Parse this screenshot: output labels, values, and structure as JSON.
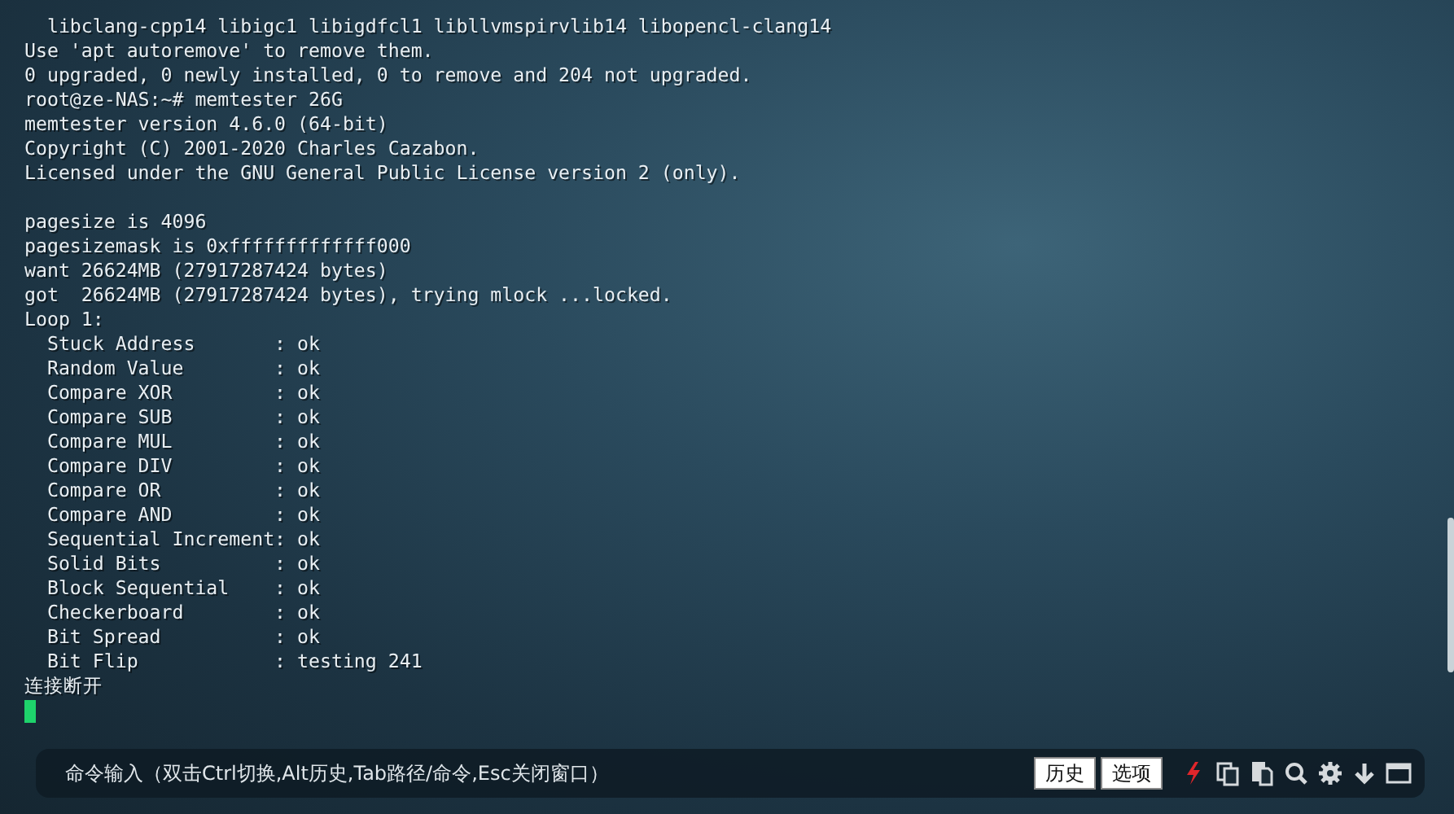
{
  "terminal": {
    "blocks": [
      [
        "  libclang-cpp14 libigc1 libigdfcl1 libllvmspirvlib14 libopencl-clang14",
        "Use 'apt autoremove' to remove them.",
        "0 upgraded, 0 newly installed, 0 to remove and 204 not upgraded.",
        "root@ze-NAS:~# memtester 26G",
        "memtester version 4.6.0 (64-bit)",
        "Copyright (C) 2001-2020 Charles Cazabon.",
        "Licensed under the GNU General Public License version 2 (only)."
      ],
      [
        "pagesize is 4096",
        "pagesizemask is 0xfffffffffffff000",
        "want 26624MB (27917287424 bytes)",
        "got  26624MB (27917287424 bytes), trying mlock ...locked.",
        "Loop 1:",
        "  Stuck Address       : ok",
        "  Random Value        : ok",
        "  Compare XOR         : ok",
        "  Compare SUB         : ok",
        "  Compare MUL         : ok",
        "  Compare DIV         : ok",
        "  Compare OR          : ok",
        "  Compare AND         : ok",
        "  Sequential Increment: ok",
        "  Solid Bits          : ok",
        "  Block Sequential    : ok",
        "  Checkerboard        : ok",
        "  Bit Spread          : ok",
        "  Bit Flip            : testing 241",
        "连接断开"
      ]
    ]
  },
  "command_bar": {
    "placeholder": "命令输入（双击Ctrl切换,Alt历史,Tab路径/命令,Esc关闭窗口）",
    "buttons": [
      "历史",
      "选项"
    ]
  }
}
